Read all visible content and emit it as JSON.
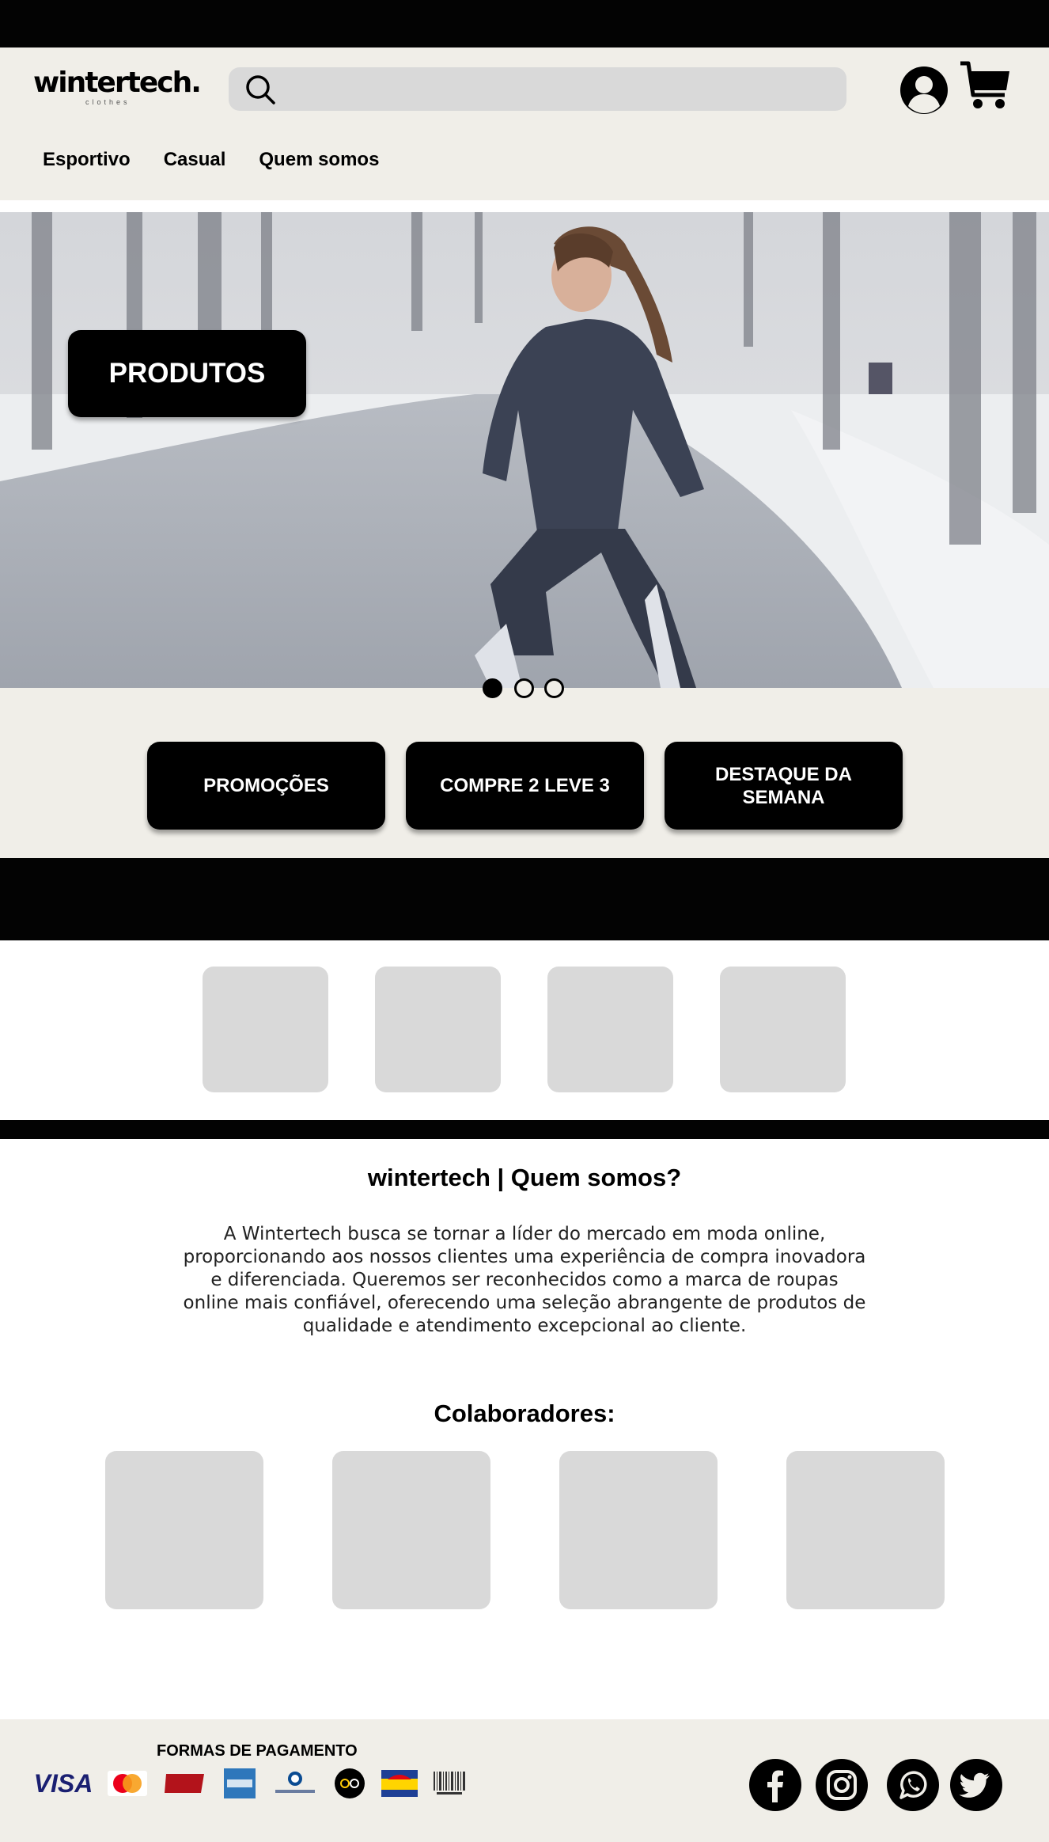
{
  "brand": {
    "name": "wintertech.",
    "tagline": "clothes"
  },
  "search": {
    "placeholder": ""
  },
  "nav": {
    "items": [
      "Esportivo",
      "Casual",
      "Quem somos"
    ]
  },
  "hero": {
    "cta_label": "PRODUTOS",
    "carousel": {
      "total": 3,
      "active_index": 0
    }
  },
  "promos": [
    {
      "label": "PROMOÇÕES"
    },
    {
      "label": "COMPRE 2 LEVE 3"
    },
    {
      "label": "DESTAQUE DA SEMANA"
    }
  ],
  "about": {
    "title": "wintertech | Quem somos?",
    "text": "A Wintertech busca se tornar a líder do mercado em moda online, proporcionando aos nossos clientes uma experiência de compra inovadora e diferenciada. Queremos ser reconhecidos como a marca de roupas online mais confiável, oferecendo uma seleção abrangente de produtos de qualidade e atendimento excepcional ao cliente."
  },
  "collaborators": {
    "title": "Colaboradores:"
  },
  "footer": {
    "payment_title": "FORMAS DE PAGAMENTO",
    "payment_methods": [
      "VISA",
      "MasterCard",
      "Hipercard",
      "American Express",
      "Diners Club",
      "elo",
      "Aura",
      "BOLETO"
    ],
    "social": [
      "facebook-icon",
      "instagram-icon",
      "whatsapp-icon",
      "twitter-icon"
    ]
  },
  "colors": {
    "dark": "#030303",
    "beige": "#f0eee8",
    "placeholder_gray": "#d9d9d9"
  }
}
